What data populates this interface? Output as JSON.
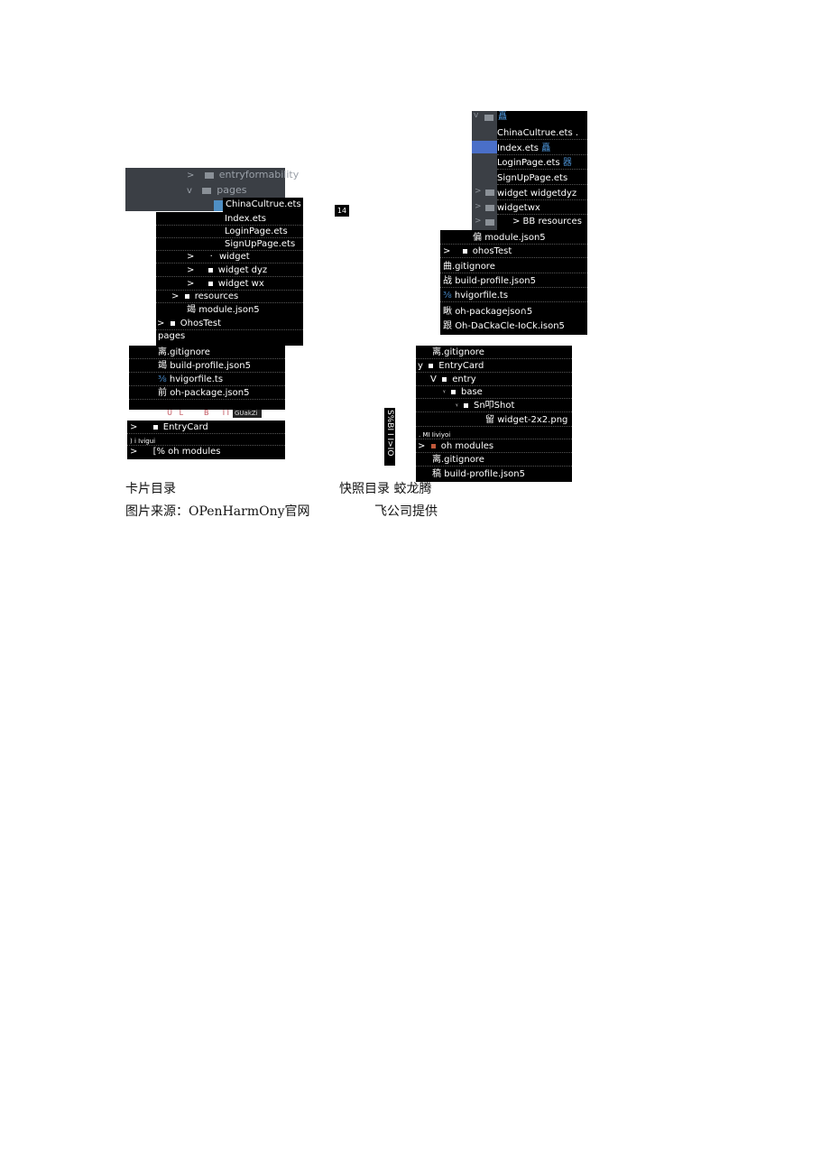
{
  "left_figure": {
    "gray_header": {
      "items": [
        {
          "chevron": ">",
          "label": "entryformability"
        },
        {
          "chevron": "v",
          "label": "pages"
        }
      ]
    },
    "selected_file": "ChinaCultrue.ets",
    "main_panel": {
      "rows": [
        {
          "label": "Index.ets"
        },
        {
          "label": "LoginPage.ets"
        },
        {
          "label": "SignUpPage.ets"
        },
        {
          "chevron": ">",
          "bullet": "·",
          "label": "widget"
        },
        {
          "chevron": ">",
          "label": "widget dyz"
        },
        {
          "chevron": ">",
          "label": "widget wx"
        },
        {
          "chevron": ">",
          "label": "resources"
        },
        {
          "glyph": "竭",
          "label": "module.json5"
        },
        {
          "chevron": ">",
          "label": "OhosTest"
        },
        {
          "label": "pages"
        }
      ]
    },
    "files_panel": {
      "rows": [
        {
          "glyph": "离",
          "label": ".gitignore"
        },
        {
          "glyph": "竭",
          "label": "build-profile.json5"
        },
        {
          "glyph": "⅜",
          "label": "hvigorfile.ts"
        },
        {
          "glyph": "前",
          "label": "oh-package.json5"
        }
      ],
      "garbled_row": "U   L         B      I I  2 L",
      "tag": "GUakZi"
    },
    "bottom_panel": {
      "rows": [
        {
          "chevron": ">",
          "label": "EntryCard"
        },
        {
          "label": ") i Ivigui",
          "tiny": true
        },
        {
          "chevron": ">",
          "label": "[% oh modules"
        }
      ]
    }
  },
  "middle_marks": {
    "badge": "14",
    "vertical_text": "S%BI I I>IO"
  },
  "right_figure": {
    "top_panel": {
      "rows": [
        {
          "glyph": "矗",
          "label": ""
        },
        {
          "label": "ChinaCultrue.ets ."
        },
        {
          "label": "Index.ets",
          "glyph_after": "矗",
          "highlight": true
        },
        {
          "label": "LoginPage.ets",
          "glyph_after": "器"
        },
        {
          "label": "SignUpPage.ets"
        },
        {
          "label": "widget widgetdyz"
        },
        {
          "label": "widgetwx"
        },
        {
          "label": "> BB resources"
        }
      ]
    },
    "middle_panel": {
      "rows": [
        {
          "glyph": "偏",
          "label": "module.json5"
        },
        {
          "chevron": ">",
          "label": "ohosTest"
        },
        {
          "glyph": "曲",
          "label": ".gitignore"
        },
        {
          "glyph": "战",
          "label": "build-profile.json5"
        },
        {
          "glyph": "⅜",
          "label": "hvigorfile.ts"
        },
        {
          "glyph": "瞅",
          "label": "oh-packagejso∩5"
        },
        {
          "glyph": "跟",
          "label": "Oh-DaCkaCle-IoCk.ison5"
        }
      ]
    },
    "bottom_panel": {
      "rows": [
        {
          "glyph": "离",
          "label": ".gitignore"
        },
        {
          "chevron": "y",
          "label": "EntryCard"
        },
        {
          "chevron": "V",
          "label": "entry"
        },
        {
          "chevron": "ᵞ",
          "label": "base"
        },
        {
          "chevron": "ᵞ",
          "label": "Sn叩Shot"
        },
        {
          "glyph": "留",
          "label": "widget-2x2.png"
        },
        {
          "label": ". MI Iiviyoi",
          "tiny": true
        },
        {
          "chevron": ">",
          "label": "oh modules",
          "red_square": true
        },
        {
          "glyph": "离",
          "label": ".gitignore"
        },
        {
          "glyph": "稿",
          "label": "build-profile.json5"
        }
      ]
    }
  },
  "captions": {
    "left_line1": "卡片目录",
    "left_line2": "图片来源：OPenHarmOny官网",
    "right_line1": "快照目录 蛟龙腾",
    "right_line2": "飞公司提供"
  }
}
